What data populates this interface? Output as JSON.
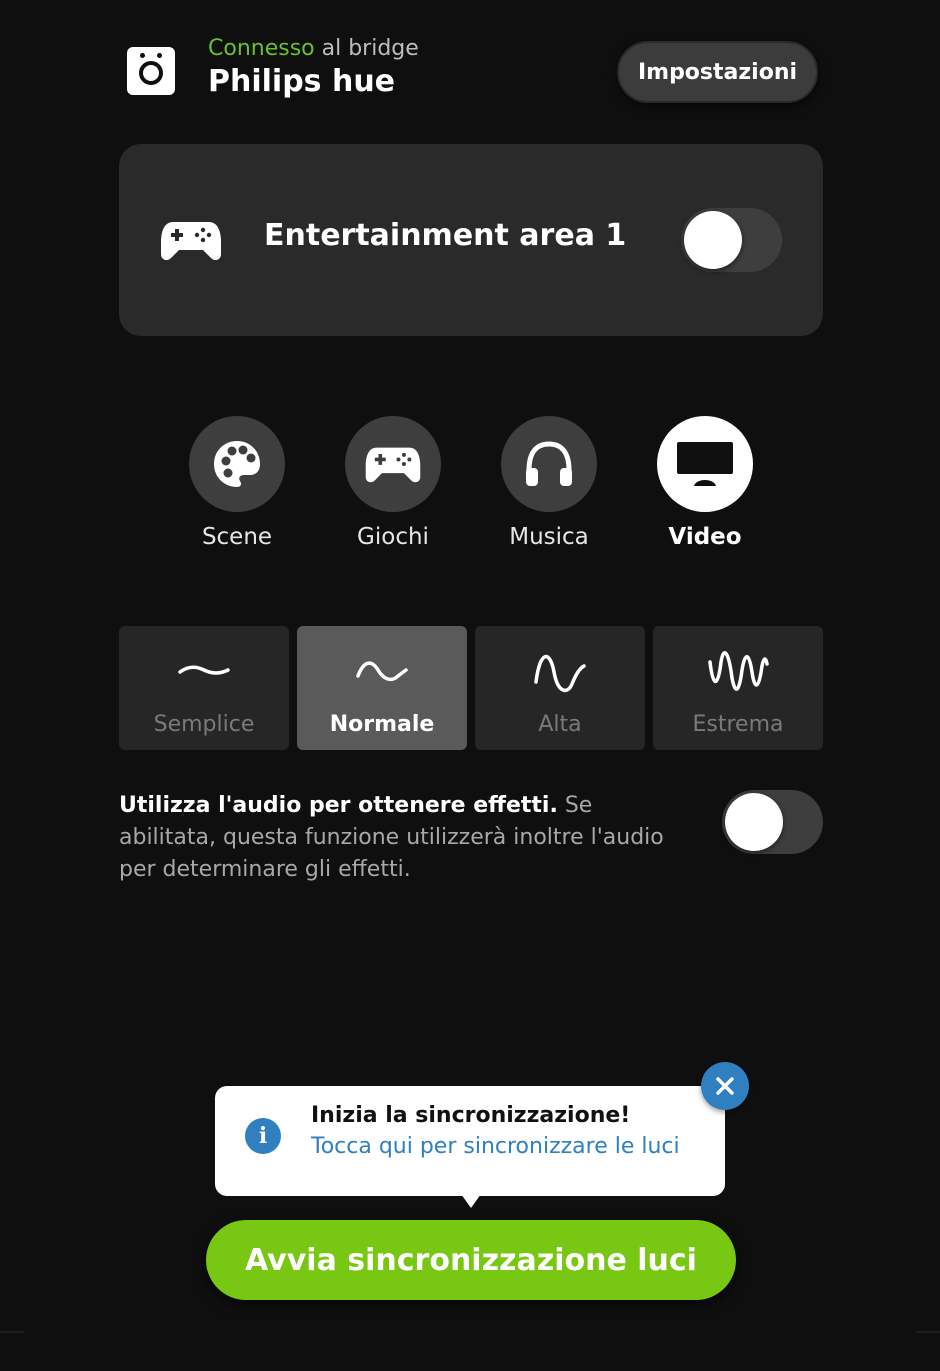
{
  "header": {
    "status_connected": "Connesso",
    "status_suffix": " al bridge",
    "title": "Philips hue",
    "settings_label": "Impostazioni",
    "bridge_icon": "bridge-icon"
  },
  "area": {
    "icon": "gamepad-icon",
    "name": "Entertainment area 1",
    "enabled": false
  },
  "modes": [
    {
      "label": "Scene",
      "icon": "palette-icon",
      "active": false
    },
    {
      "label": "Giochi",
      "icon": "gamepad-icon",
      "active": false
    },
    {
      "label": "Musica",
      "icon": "headphones-icon",
      "active": false
    },
    {
      "label": "Video",
      "icon": "monitor-icon",
      "active": true
    }
  ],
  "intensity": [
    {
      "label": "Semplice",
      "icon": "wave-low-icon",
      "active": false
    },
    {
      "label": "Normale",
      "icon": "wave-medium-icon",
      "active": true
    },
    {
      "label": "Alta",
      "icon": "wave-high-icon",
      "active": false
    },
    {
      "label": "Estrema",
      "icon": "wave-extreme-icon",
      "active": false
    }
  ],
  "audio": {
    "title": "Utilizza l'audio per ottenere effetti.",
    "description": " Se abilitata, questa funzione utilizzerà inoltre l'audio per determinare gli effetti.",
    "enabled": false
  },
  "tooltip": {
    "title": "Inizia la sincronizzazione!",
    "subtitle": "Tocca qui per sincronizzare le luci"
  },
  "cta": {
    "label": "Avvia sincronizzazione luci"
  },
  "colors": {
    "accent_green": "#77c713",
    "connected_green": "#6cbf2a",
    "info_blue": "#2f7fc1",
    "background": "#0f0f0f"
  }
}
